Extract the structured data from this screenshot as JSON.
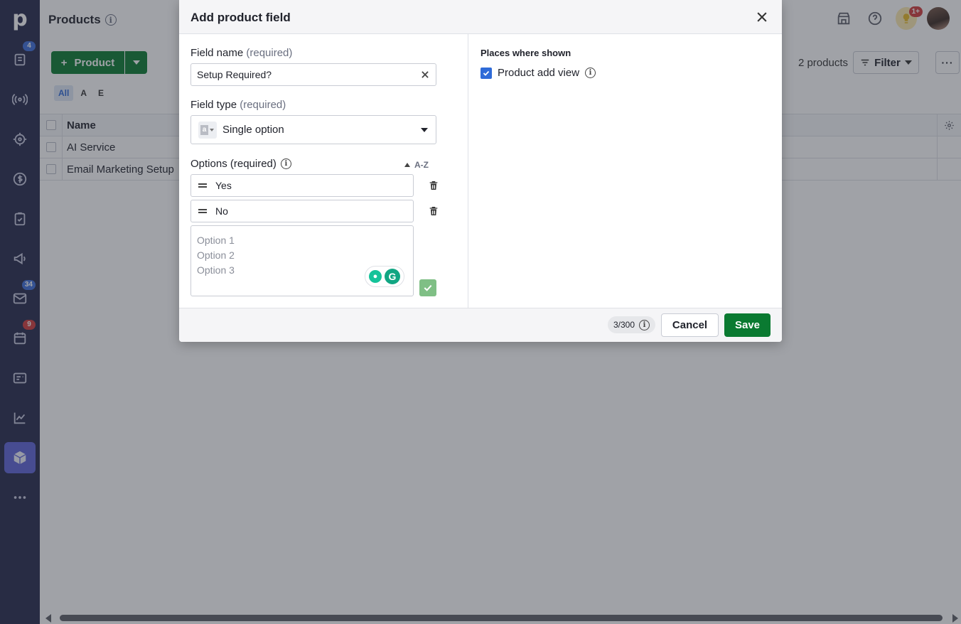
{
  "sidebar": {
    "logo": "p",
    "items": [
      {
        "name": "deals",
        "badge": "4",
        "badge_color": "blue"
      },
      {
        "name": "leads",
        "badge": ""
      },
      {
        "name": "contacts",
        "badge": ""
      },
      {
        "name": "revenue",
        "badge": ""
      },
      {
        "name": "tasks",
        "badge": ""
      },
      {
        "name": "campaigns",
        "badge": ""
      },
      {
        "name": "mail",
        "badge": "34",
        "badge_color": "blue"
      },
      {
        "name": "calendar",
        "badge": "9",
        "badge_color": "red"
      },
      {
        "name": "contacts-card",
        "badge": ""
      },
      {
        "name": "insights",
        "badge": ""
      },
      {
        "name": "products",
        "badge": "",
        "active": true
      },
      {
        "name": "more",
        "badge": ""
      }
    ]
  },
  "header": {
    "title": "Products",
    "notifications_badge": "1+",
    "add_button_label": "Product",
    "product_count": "2 products",
    "filter_label": "Filter",
    "more_label": "···"
  },
  "filter_tabs": [
    "All",
    "A",
    "E"
  ],
  "table": {
    "column_name": "Name",
    "rows": [
      "AI Service",
      "Email Marketing Setup"
    ]
  },
  "modal": {
    "title": "Add product field",
    "field_name_label": "Field name",
    "field_name_req": "(required)",
    "field_name_value": "Setup Required?",
    "field_type_label": "Field type",
    "field_type_req": "(required)",
    "field_type_value": "Single option",
    "field_type_icon_letter": "a",
    "options_label": "Options (required)",
    "sort_label": "A-Z",
    "options": [
      "Yes",
      "No"
    ],
    "new_options_placeholder": "Option 1\nOption 2\nOption 3",
    "places_title": "Places where shown",
    "places_item": "Product add view",
    "char_count": "3/300",
    "cancel_label": "Cancel",
    "save_label": "Save"
  },
  "colors": {
    "sidebar_bg": "#26294b",
    "primary_green": "#0a7a31",
    "accent_blue": "#2f6bd8"
  }
}
